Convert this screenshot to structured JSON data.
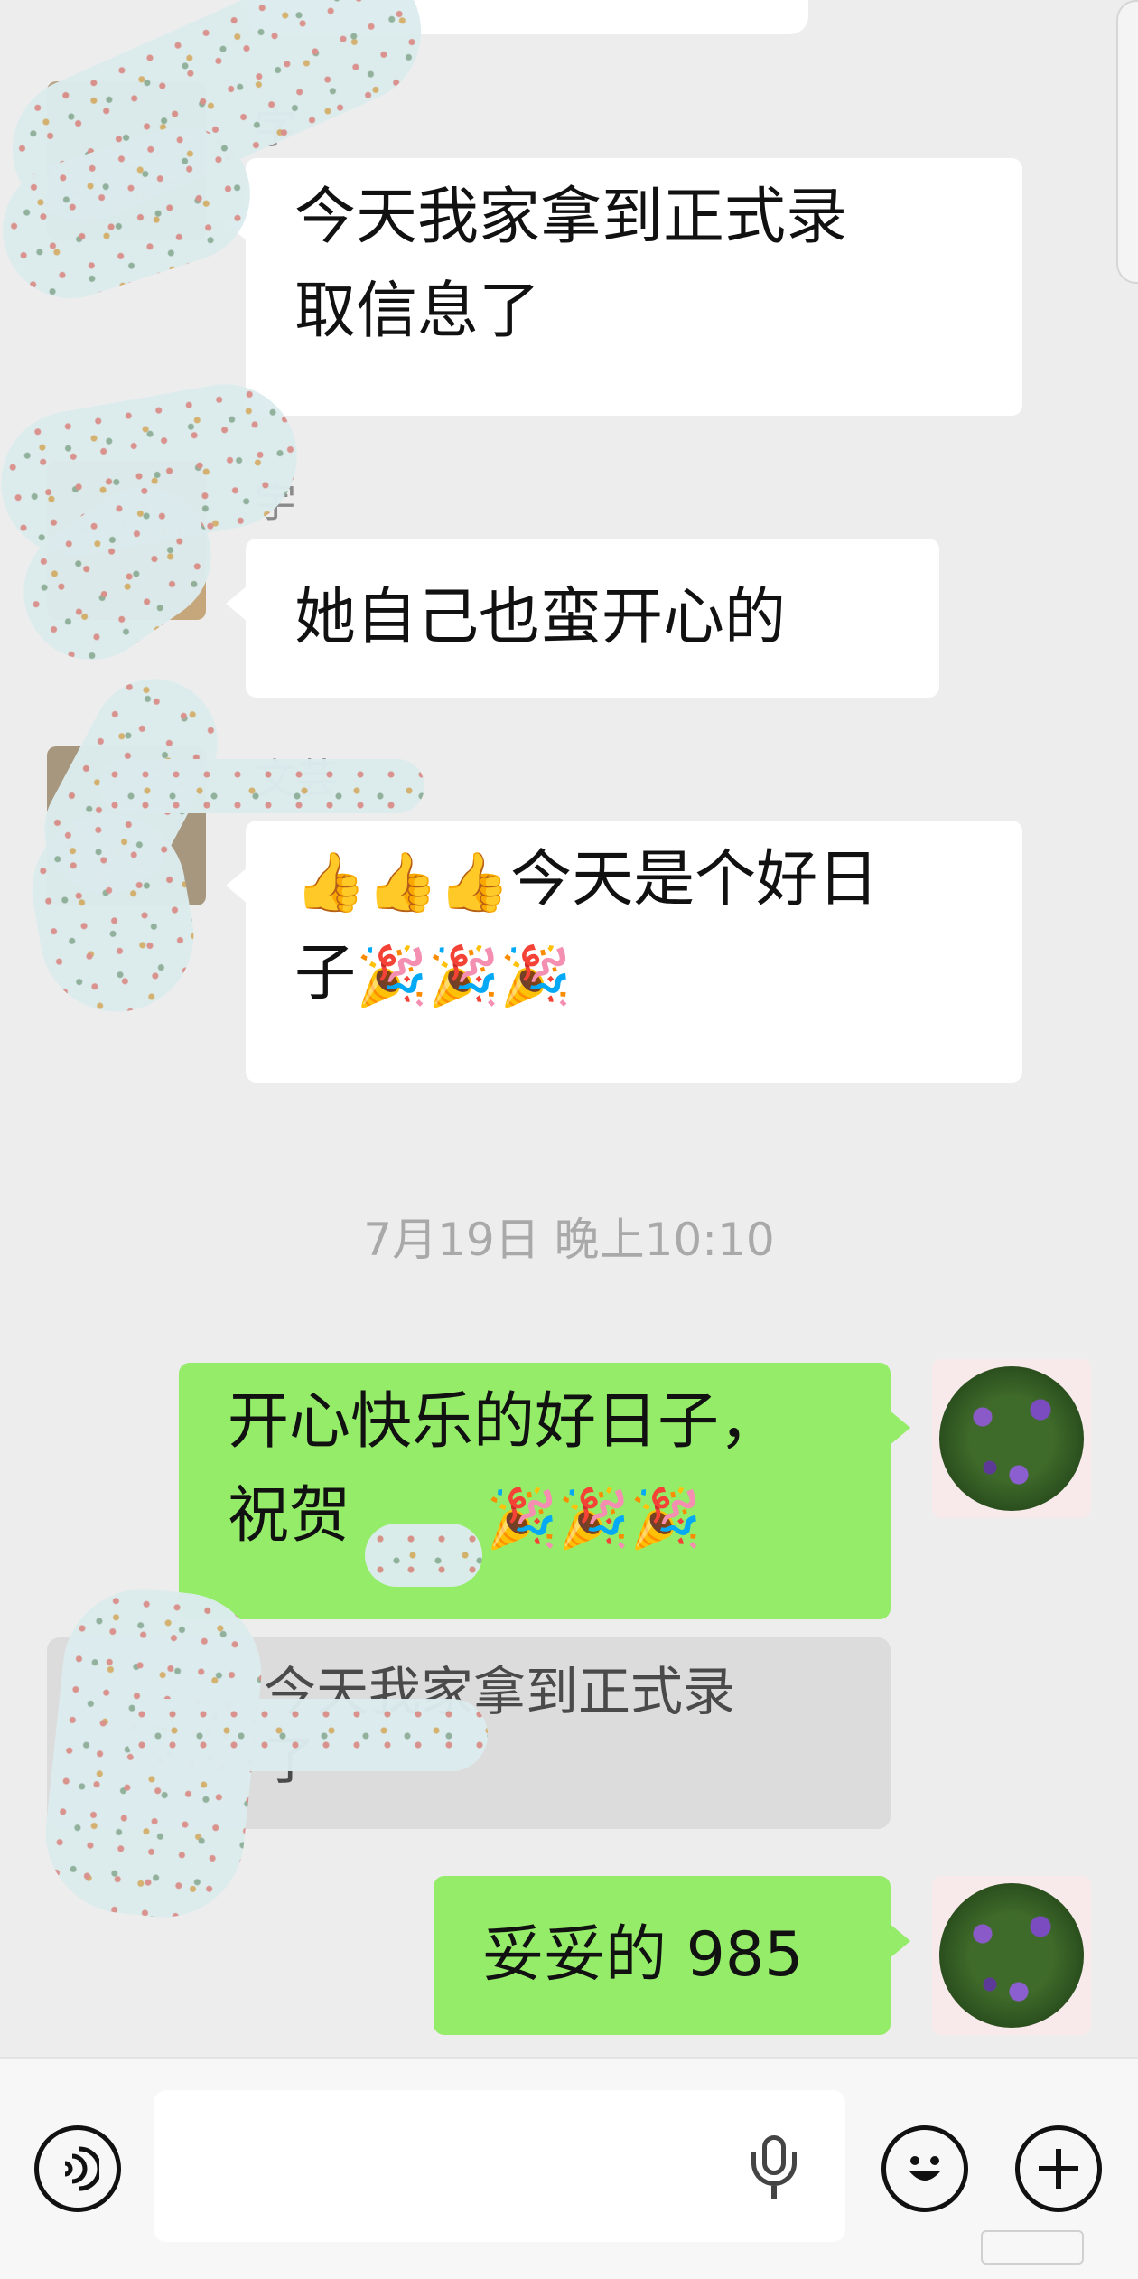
{
  "messages": [
    {
      "text": "今天我家拿到正式录取信息了",
      "line1": "今天我家拿到正式录",
      "line2": "取信息了",
      "sender_partial": "字"
    },
    {
      "text": "她自己也蛮开心的",
      "sender_partial": "宇"
    },
    {
      "line1_emoji": "👍👍👍",
      "line1_text": "今天是个好日",
      "line2_text": "子",
      "line2_emoji": "🎉🎉🎉",
      "sender_partial": "文芸"
    }
  ],
  "timestamp": "7月19日 晚上10:10",
  "outgoing": [
    {
      "line1": "开心快乐的好日子，",
      "line2_text": "祝贺",
      "line2_emoji": "🎉🎉🎉"
    },
    {
      "text": "妥妥的 985"
    }
  ],
  "quote": {
    "text": "今天我家拿到正式录",
    "line2": "了"
  },
  "toolbar": {
    "voice_label": "voice",
    "emoji_label": "☺",
    "add_label": "+"
  }
}
